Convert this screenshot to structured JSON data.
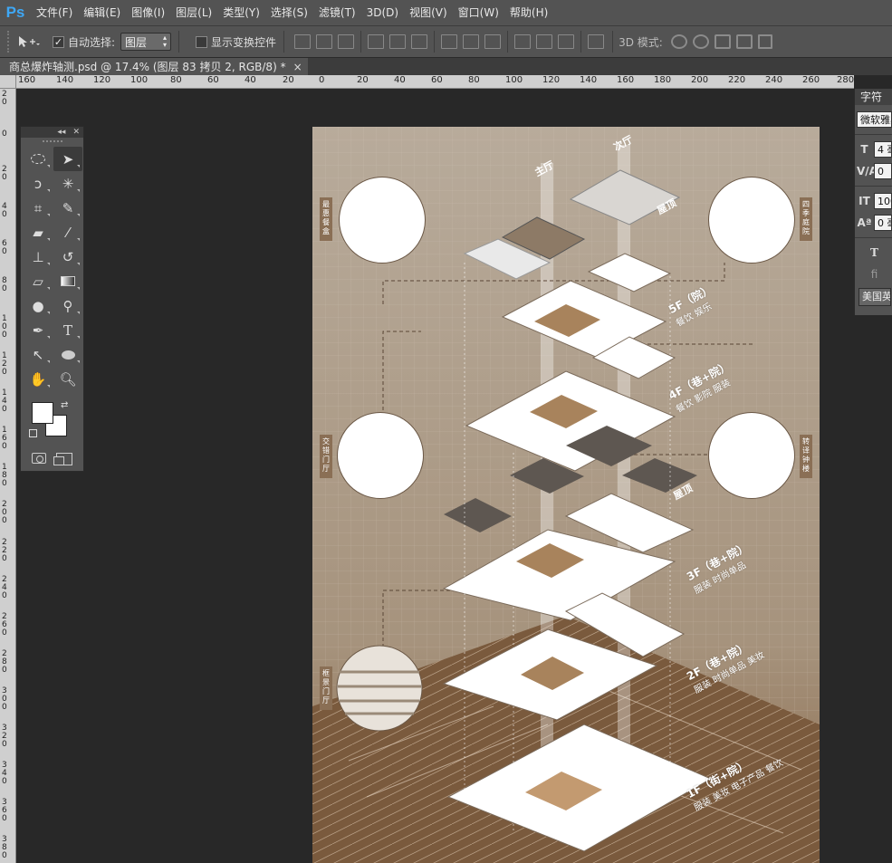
{
  "app": {
    "logo": "Ps"
  },
  "menu": [
    "文件(F)",
    "编辑(E)",
    "图像(I)",
    "图层(L)",
    "类型(Y)",
    "选择(S)",
    "滤镜(T)",
    "3D(D)",
    "视图(V)",
    "窗口(W)",
    "帮助(H)"
  ],
  "options": {
    "auto_select_label": "自动选择:",
    "auto_select_checked": "✓",
    "layer_select": "图层",
    "show_transform_label": "显示变换控件",
    "mode3d_label": "3D 模式:"
  },
  "document_tab": {
    "title": "商总爆炸轴测.psd @ 17.4% (图层 83 拷贝 2, RGB/8) *",
    "close": "×"
  },
  "ruler_h": [
    "160",
    "140",
    "120",
    "100",
    "80",
    "60",
    "40",
    "20",
    "0",
    "20",
    "40",
    "60",
    "80",
    "100",
    "120",
    "140",
    "160",
    "180",
    "200",
    "220",
    "240",
    "260",
    "280"
  ],
  "ruler_v": [
    "2 0",
    "0",
    "2 0",
    "4 0",
    "6 0",
    "8 0",
    "1 0 0",
    "1 2 0",
    "1 4 0",
    "1 6 0",
    "1 8 0",
    "2 0 0",
    "2 2 0",
    "2 4 0",
    "2 6 0",
    "2 8 0",
    "3 0 0",
    "3 2 0",
    "3 4 0",
    "3 6 0",
    "3 8 0"
  ],
  "character_panel": {
    "tab": "字符",
    "font": "微软雅黑",
    "size": "4 毫",
    "kerning": "0",
    "scale": "100",
    "baseline": "0 毫",
    "language": "美国英语"
  },
  "artboard": {
    "side_tags": [
      "最惠餐盒",
      "四季庭院",
      "交错门厅",
      "转译钟楼",
      "框景门厅"
    ],
    "beams": [
      "主厅",
      "次厅"
    ],
    "roof_labels": [
      "屋顶",
      "屋顶"
    ],
    "floors": [
      {
        "title": "5F（院）",
        "sub": "餐饮 娱乐"
      },
      {
        "title": "4F（巷+院）",
        "sub": "餐饮 影院 服装"
      },
      {
        "title": "3F（巷+院）",
        "sub": "服装 时尚单品"
      },
      {
        "title": "2F（巷+院）",
        "sub": "服装 时尚单品 美妆"
      },
      {
        "title": "1F（街+院）",
        "sub": "服装 美妆 电子产品 餐饮"
      }
    ]
  }
}
